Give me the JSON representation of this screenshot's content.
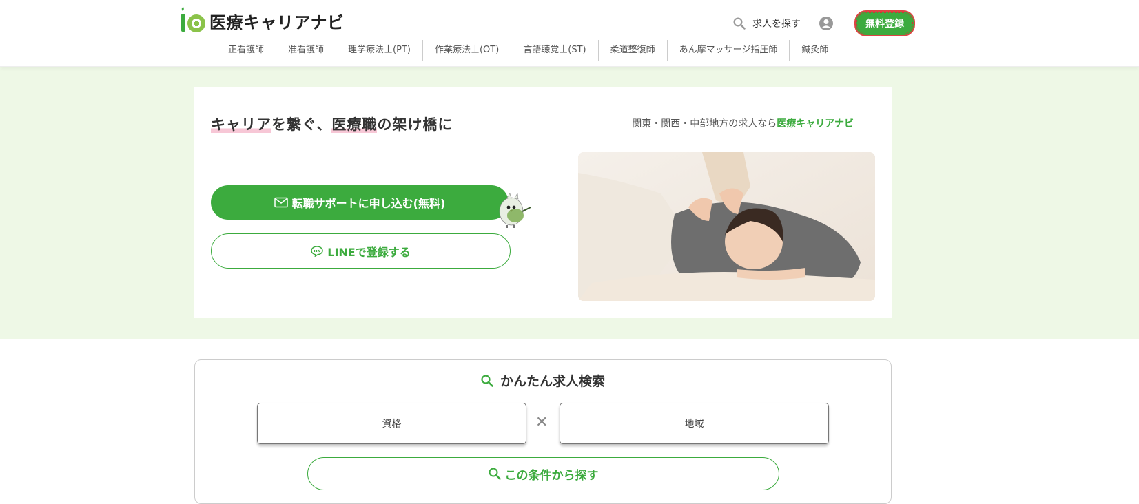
{
  "header": {
    "logo_text": "医療キャリアナビ",
    "search_label": "求人を探す",
    "register_label": "無料登録"
  },
  "nav": [
    {
      "label": "正看護師"
    },
    {
      "label": "准看護師"
    },
    {
      "label": "理学療法士(PT)"
    },
    {
      "label": "作業療法士(OT)"
    },
    {
      "label": "言語聴覚士(ST)"
    },
    {
      "label": "柔道整復師"
    },
    {
      "label": "あん摩マッサージ指圧師"
    },
    {
      "label": "鍼灸師"
    }
  ],
  "hero": {
    "tagline_part1": "キャリア",
    "tagline_part2": "を繋ぐ、",
    "tagline_part3": "医療職",
    "tagline_part4": "の架け橋に",
    "subtag_prefix": "関東・関西・中部地方の求人なら",
    "subtag_brand": "医療キャリアナビ",
    "support_button": "転職サポートに申し込む(無料)",
    "line_button": "LINEで登録する"
  },
  "search": {
    "title": "かんたん求人検索",
    "qualification_placeholder": "資格",
    "area_placeholder": "地域",
    "find_button": "この条件から探す"
  },
  "colors": {
    "brand_green": "#3cab3e",
    "band_bg": "#eef8e6",
    "highlight_pink": "#f7c7d6"
  }
}
